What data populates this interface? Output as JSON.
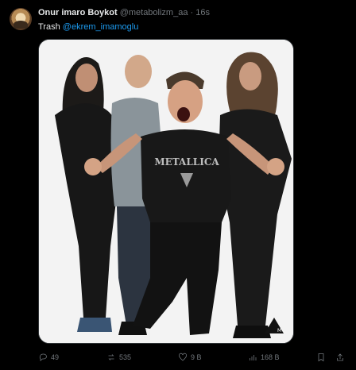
{
  "tweet": {
    "author_name": "Onur imaro Boykot",
    "handle": "@metabolizm_aa",
    "separator": "·",
    "time": "16s",
    "text_prefix": "Trash",
    "mention": "@ekrem_imamoglu"
  },
  "media": {
    "shirt_text": "METALLICA",
    "logo_icon": "metallica-triangle-logo"
  },
  "actions": {
    "reply_count": "49",
    "retweet_count": "535",
    "like_count": "9 B",
    "views_count": "168 B"
  },
  "colors": {
    "background": "#000000",
    "text": "#e7e9ea",
    "muted": "#71767b",
    "link": "#1d9bf0"
  }
}
